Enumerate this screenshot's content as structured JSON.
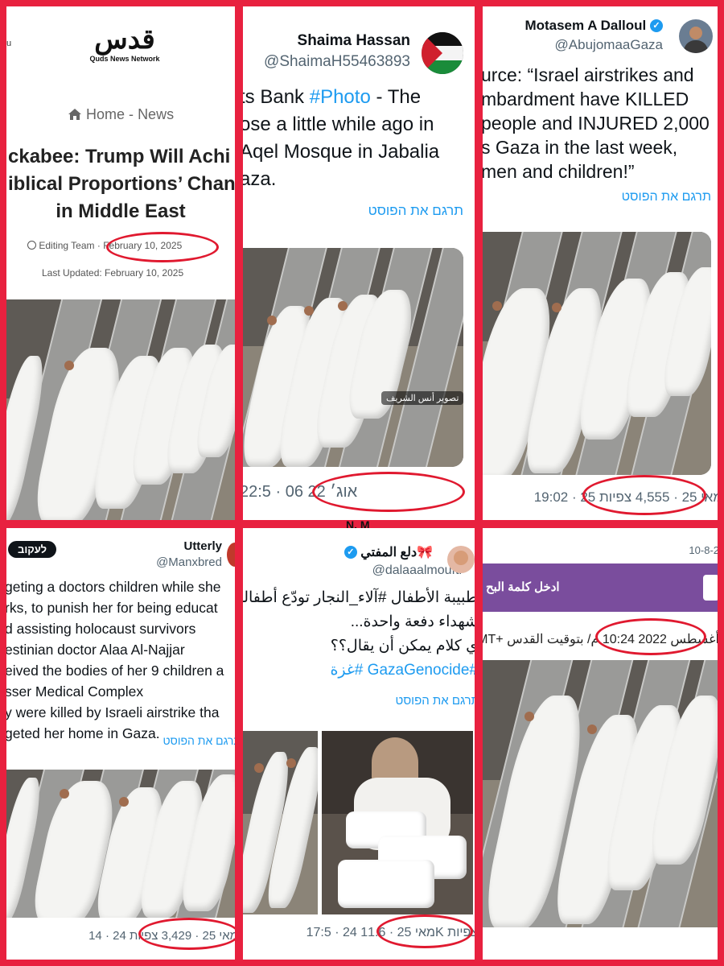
{
  "panel1": {
    "logo_text": "قدس",
    "logo_sub": "Quds News Network",
    "left_edge": "u",
    "breadcrumb_home": "Home",
    "breadcrumb_sep": "-",
    "breadcrumb_news": "News",
    "headline_1": "ckabee: Trump Will Achi",
    "headline_2": "iblical Proportions’ Chan",
    "headline_3": "in Middle East",
    "author": "Editing Team",
    "date": "February 10, 2025",
    "last_updated": "Last Updated: February 10, 2025"
  },
  "panel2": {
    "name": "Shaima Hassan",
    "handle": "@ShaimaH55463893",
    "line1_pre": "ts Bank ",
    "line1_tag": "#Photo",
    "line1_post": " - The",
    "line2": "ose a little while ago in",
    "line3": "Aqel Mosque in Jabalia",
    "line4": "aza.",
    "translate": "תרגם את הפוסט",
    "photo_credit": "تصوير أنس الشريف",
    "timestamp": "22:5 · 06 אוג׳ 22"
  },
  "panel3": {
    "name": "Motasem A Dalloul",
    "handle": "@AbujomaaGaza",
    "line1": "urce: “Israel airstrikes and",
    "line2": "mbardment have KILLED",
    "line3": "people and INJURED 2,000",
    "line4": "s Gaza in the last week,",
    "line5": "men and children!”",
    "translate": "תרגם את הפוסט",
    "stats": "19:02 · 25 מאי 25 · 4,555 צפיות"
  },
  "mark": "N. M",
  "panel4": {
    "follow": "לעקוב",
    "name": "Utterly",
    "handle": "@Manxbred",
    "line1": "geting a doctors children while she",
    "line2": "rks, to punish her for being educat",
    "line3": "d assisting holocaust survivors",
    "line4": "estinian doctor Alaa Al-Najjar",
    "line5": "eived the bodies of her 9 children a",
    "line6": "sser Medical Complex",
    "line7": "y were killed by Israeli airstrike tha",
    "line8": "geted her home in Gaza.",
    "translate": "תרגם את הפוסט",
    "stats": "14 · 24 מאי 25 · 3,429 צפיות"
  },
  "panel5": {
    "name": "دلع المفتي🎀",
    "handle": "@dalaaalmoufti",
    "line1": "طبيبة الأطفال #آلاء_النجار تودّع أطفالها",
    "line2": "شهداء دفعة واحدة...",
    "line3": "ي كلام يمكن أن يقال؟؟",
    "line4": "#GazaGenocide #غزة",
    "translate": "תרגם את הפוסט",
    "stats": "17:5 · 24 מאי 25 · 11.6K צפיות"
  },
  "panel6": {
    "top_date": "10-8-2",
    "login_text": "ادخل كلمة البح",
    "date": "أغسطس 2022 10:24 م/ بتوقيت القدس +GMT"
  },
  "colors": {
    "frame": "#e8213f",
    "circle": "#e0192f",
    "link": "#1d9bf0",
    "purple_bar": "#7a4d9d"
  },
  "icons": [
    "home-icon",
    "user-icon",
    "verified-icon",
    "avatar"
  ]
}
